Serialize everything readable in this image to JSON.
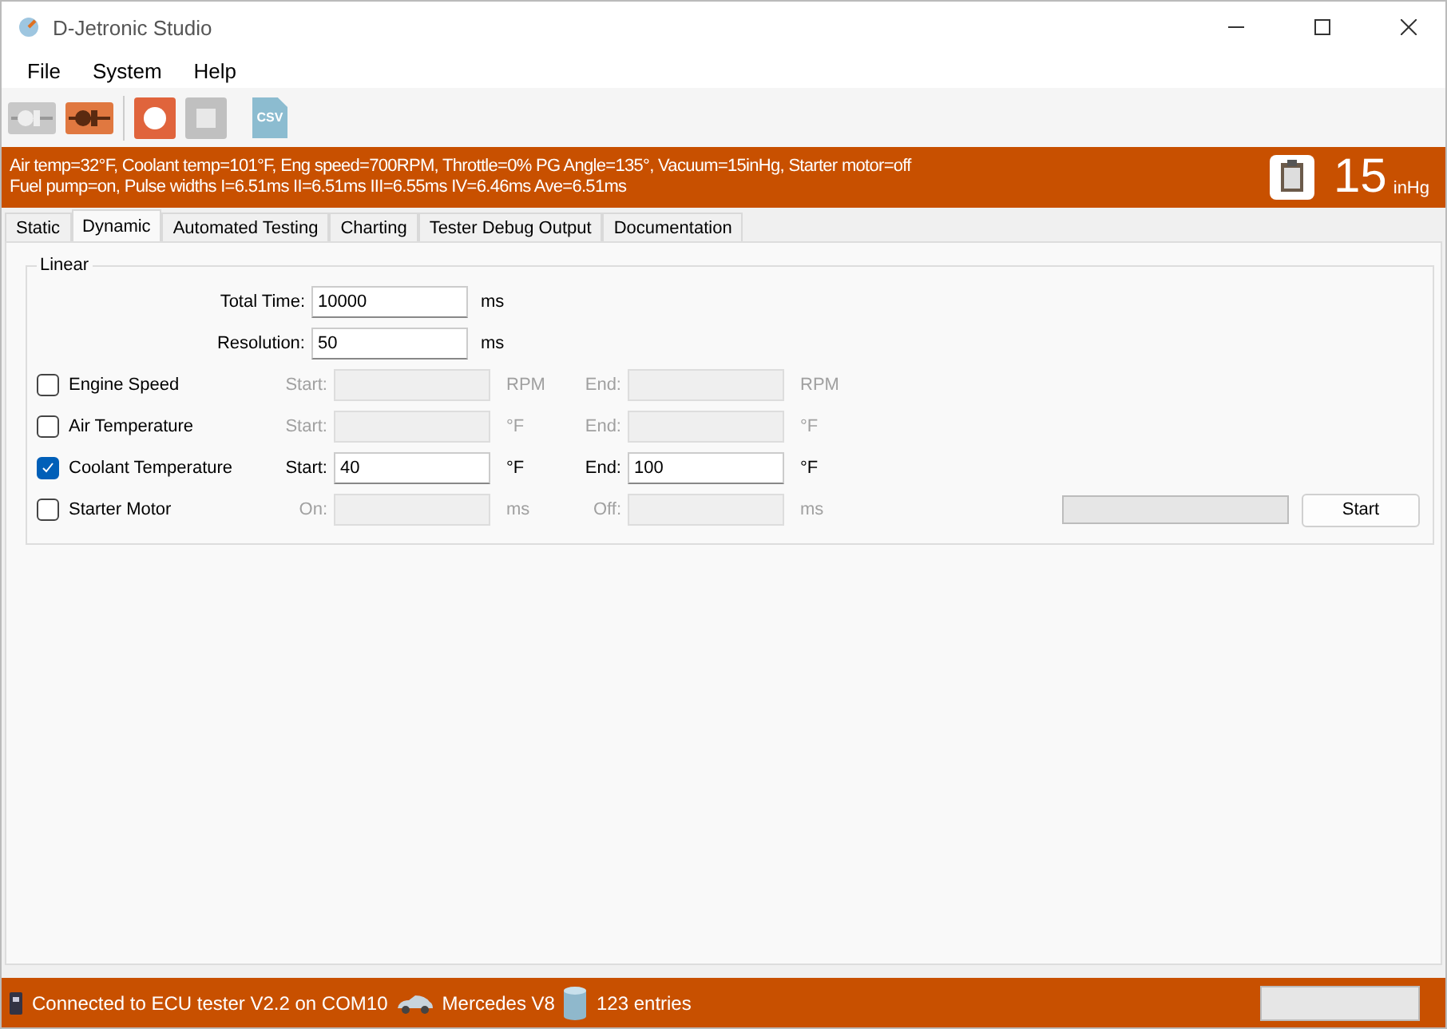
{
  "window": {
    "title": "D-Jetronic Studio"
  },
  "menu": [
    "File",
    "System",
    "Help"
  ],
  "toolbar": [
    {
      "kind": "plug",
      "disabled": true
    },
    {
      "kind": "plug",
      "disabled": false
    },
    {
      "kind": "sep"
    },
    {
      "kind": "record",
      "disabled": false
    },
    {
      "kind": "stop",
      "disabled": true
    },
    {
      "kind": "csv",
      "label": "CSV",
      "disabled": false
    }
  ],
  "info_bar": {
    "lines": [
      "Air temp=32°F, Coolant temp=101°F, Eng speed=700RPM, Throttle=0% PG Angle=135°, Vacuum=15inHg, Starter motor=off",
      "Fuel pump=on, Pulse widths I=6.51ms II=6.51ms III=6.55ms IV=6.46ms Ave=6.51ms"
    ],
    "reading": "15",
    "unit": "inHg"
  },
  "tabs": [
    {
      "label": "Static",
      "selected": false
    },
    {
      "label": "Dynamic",
      "selected": true
    },
    {
      "label": "Automated Testing",
      "selected": false
    },
    {
      "label": "Charting",
      "selected": false
    },
    {
      "label": "Tester Debug Output",
      "selected": false
    },
    {
      "label": "Documentation",
      "selected": false
    }
  ],
  "group": {
    "title": "Linear",
    "settings": [
      {
        "label": "Total Time:",
        "value": "10000",
        "unit": "ms"
      },
      {
        "label": "Resolution:",
        "value": "50",
        "unit": "ms"
      }
    ],
    "channels": [
      {
        "name": "Engine Speed",
        "checked": false,
        "start_label": "Start:",
        "start_unit": "RPM",
        "end_label": "End:",
        "end_unit": "RPM"
      },
      {
        "name": "Air Temperature",
        "checked": false,
        "start_label": "Start:",
        "start_unit": "°F",
        "end_label": "End:",
        "end_unit": "°F"
      },
      {
        "name": "Coolant Temperature",
        "checked": true,
        "start_label": "Start:",
        "start_value": "40",
        "start_unit": "°F",
        "end_label": "End:",
        "end_value": "100",
        "end_unit": "°F"
      },
      {
        "name": "Starter Motor",
        "checked": false,
        "start_label": "On:",
        "start_unit": "ms",
        "end_label": "Off:",
        "end_unit": "ms"
      }
    ],
    "progress": {
      "level": 0
    },
    "start_button": "Start"
  },
  "status_bar": {
    "connection": "Connected to ECU tester V2.2 on COM10",
    "vehicle": "Mercedes V8",
    "entries": "123 entries",
    "progress": {
      "level": 0
    }
  }
}
